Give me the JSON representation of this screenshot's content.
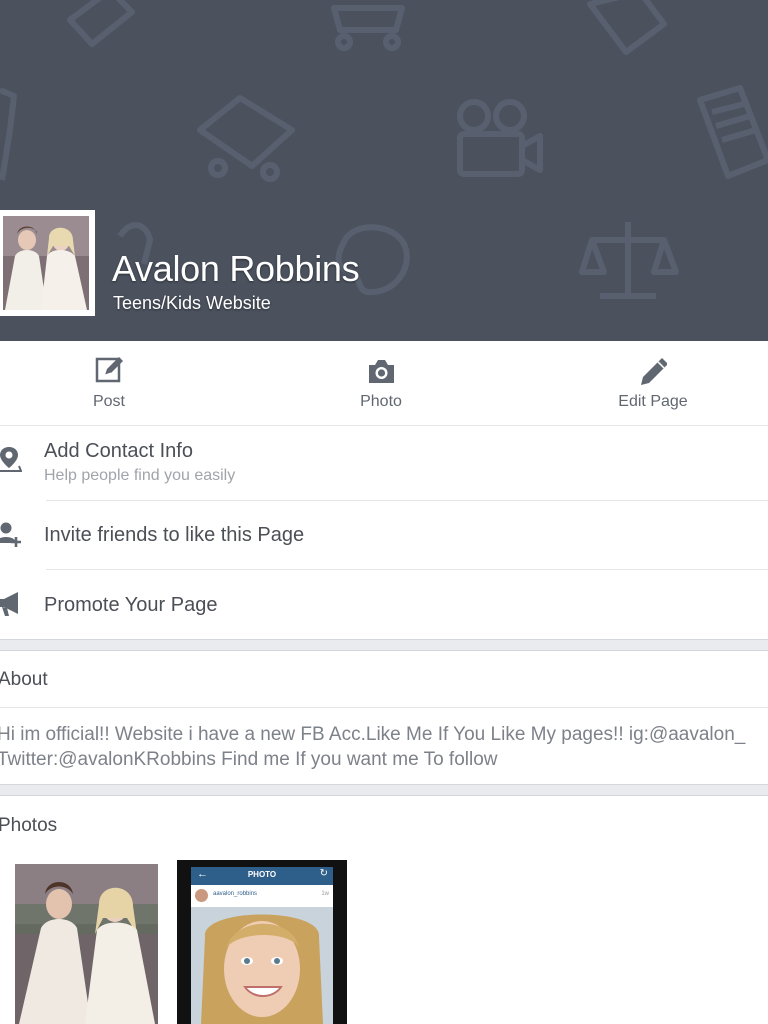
{
  "page": {
    "name": "Avalon Robbins",
    "category": "Teens/Kids Website"
  },
  "actions": [
    {
      "label": "Post",
      "icon": "compose-icon"
    },
    {
      "label": "Photo",
      "icon": "camera-icon"
    },
    {
      "label": "Edit Page",
      "icon": "pencil-icon"
    }
  ],
  "info_items": [
    {
      "title": "Add Contact Info",
      "subtitle": "Help people find you easily",
      "icon": "location-pin-icon"
    },
    {
      "title": "Invite friends to like this Page",
      "icon": "add-friend-icon"
    },
    {
      "title": "Promote Your Page",
      "icon": "megaphone-icon"
    }
  ],
  "about": {
    "heading": "About",
    "line1": "Hi im official!! Website i have a new FB Acc.Like Me If You Like My pages!! ig:@aavalon_",
    "line2": "Twitter:@avalonKRobbins Find me If you want me To follow"
  },
  "photos": {
    "heading": "Photos",
    "thumb2_header": "PHOTO",
    "thumb2_username": "aavalon_robbins",
    "thumb2_time": "1w"
  },
  "colors": {
    "cover_bg": "#4b525e",
    "icon_gray": "#616770",
    "section_gap": "#e9ebee",
    "instagram_bar": "#2e5f8a"
  }
}
